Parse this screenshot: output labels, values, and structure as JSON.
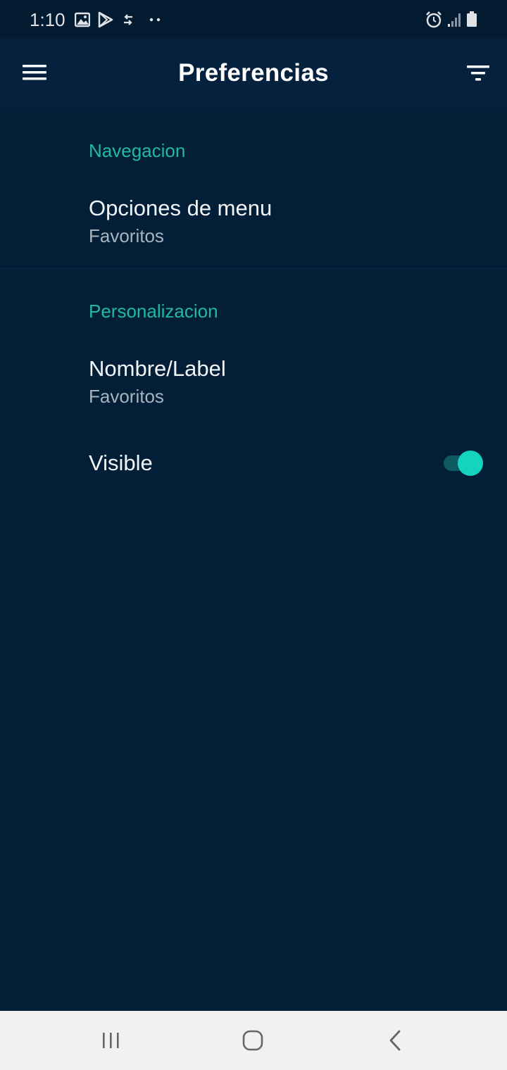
{
  "status_bar": {
    "time": "1:10",
    "left_icons": [
      "gallery-icon",
      "play-store-icon",
      "data-transfer-icon",
      "more-notifications-icon"
    ],
    "right_icons": [
      "alarm-icon",
      "signal-icon",
      "battery-icon"
    ]
  },
  "app_bar": {
    "title": "Preferencias",
    "menu_icon": "hamburger-menu-icon",
    "filter_icon": "filter-icon"
  },
  "sections": [
    {
      "header": "Navegacion",
      "items": [
        {
          "title": "Opciones de menu",
          "summary": "Favoritos"
        }
      ]
    },
    {
      "header": "Personalizacion",
      "items": [
        {
          "title": "Nombre/Label",
          "summary": "Favoritos"
        },
        {
          "title": "Visible",
          "toggle_on": true
        }
      ]
    }
  ],
  "nav_bar": {
    "icons": [
      "recent-apps-icon",
      "home-icon",
      "back-icon"
    ]
  },
  "colors": {
    "background": "#031f38",
    "app_bar": "#04223e",
    "accent": "#1fb9a6",
    "toggle_thumb": "#14d4bf",
    "nav_bar": "#f1f1f1"
  }
}
